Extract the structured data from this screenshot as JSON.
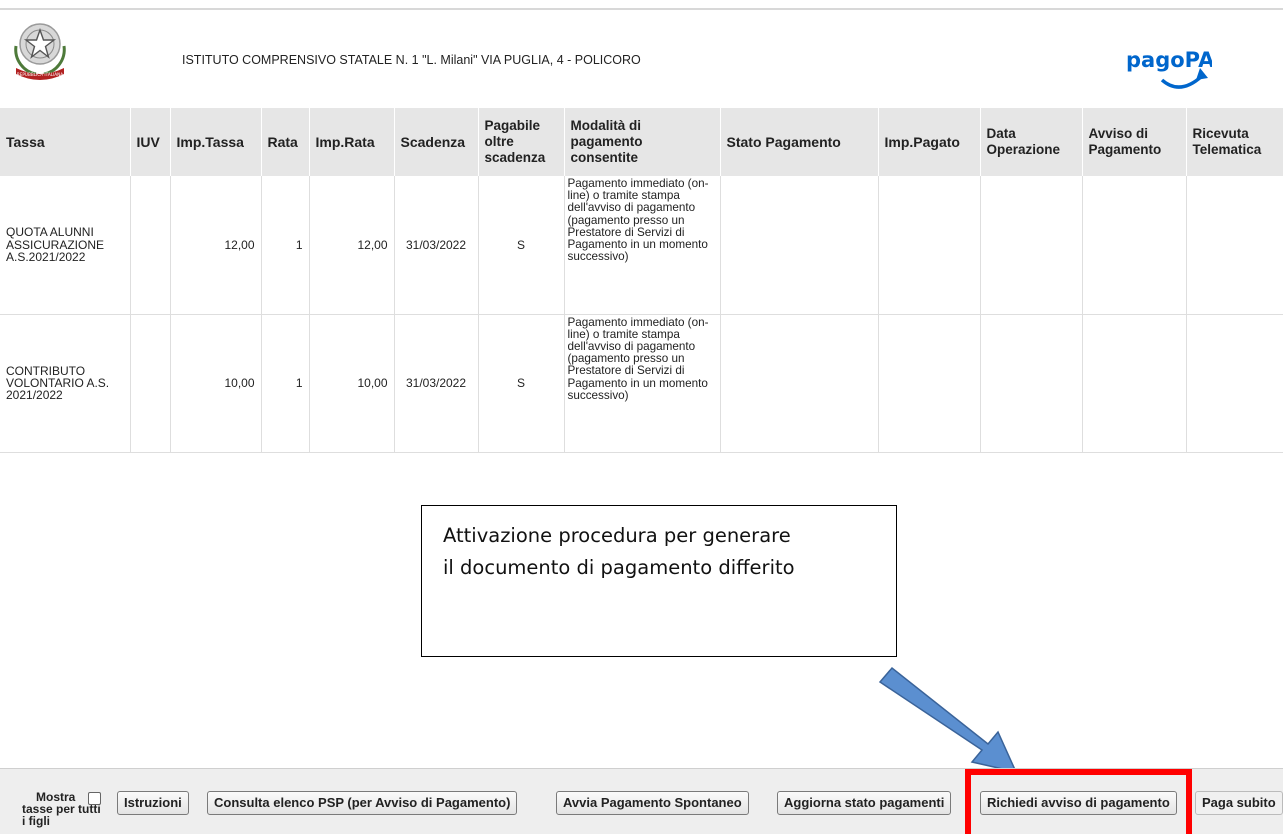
{
  "header": {
    "school_name": "ISTITUTO COMPRENSIVO STATALE N. 1 \"L. Milani\" VIA PUGLIA, 4 - POLICORO",
    "emblem_text": "REPUBBLICA ITALIANA",
    "logo_text": "pagoPA"
  },
  "table": {
    "columns": [
      "Tassa",
      "IUV",
      "Imp.Tassa",
      "Rata",
      "Imp.Rata",
      "Scadenza",
      "Pagabile oltre scadenza",
      "Modalità di pagamento consentite",
      "Stato Pagamento",
      "Imp.Pagato",
      "Data Operazione",
      "Avviso di Pagamento",
      "Ricevuta Telematica"
    ],
    "rows": [
      {
        "tassa": "QUOTA ALUNNI ASSICURAZIONE A.S.2021/2022",
        "iuv": "",
        "imp_tassa": "12,00",
        "rata": "1",
        "imp_rata": "12,00",
        "scadenza": "31/03/2022",
        "pagabile": "S",
        "modalita": "Pagamento immediato (on-line) o tramite stampa dell'avviso di pagamento (pagamento presso un Prestatore di Servizi di Pagamento in un momento successivo)",
        "stato": "",
        "imp_pagato": "",
        "data_operazione": "",
        "avviso": "",
        "ricevuta": ""
      },
      {
        "tassa": "CONTRIBUTO VOLONTARIO A.S. 2021/2022",
        "iuv": "",
        "imp_tassa": "10,00",
        "rata": "1",
        "imp_rata": "10,00",
        "scadenza": "31/03/2022",
        "pagabile": "S",
        "modalita": "Pagamento immediato (on-line) o tramite stampa dell'avviso di pagamento (pagamento presso un Prestatore di Servizi di Pagamento in un momento successivo)",
        "stato": "",
        "imp_pagato": "",
        "data_operazione": "",
        "avviso": "",
        "ricevuta": ""
      }
    ]
  },
  "annotation": {
    "line1": "Attivazione procedura per generare",
    "line2": "il documento di pagamento differito"
  },
  "footer": {
    "show_all_label_1": "Mostra",
    "show_all_label_2": "tasse per tutti i figli",
    "buttons": {
      "istruzioni": "Istruzioni",
      "consulta": "Consulta elenco PSP (per Avviso di Pagamento)",
      "avvia": "Avvia Pagamento Spontaneo",
      "aggiorna": "Aggiorna stato pagamenti",
      "richiedi": "Richiedi avviso di pagamento",
      "paga": "Paga subito"
    }
  },
  "colors": {
    "highlight": "#ff0000",
    "arrow_fill": "#5b8fd0",
    "arrow_stroke": "#3a6399",
    "header_bg": "#e6e6e6",
    "logo_blue": "#0066cc"
  }
}
